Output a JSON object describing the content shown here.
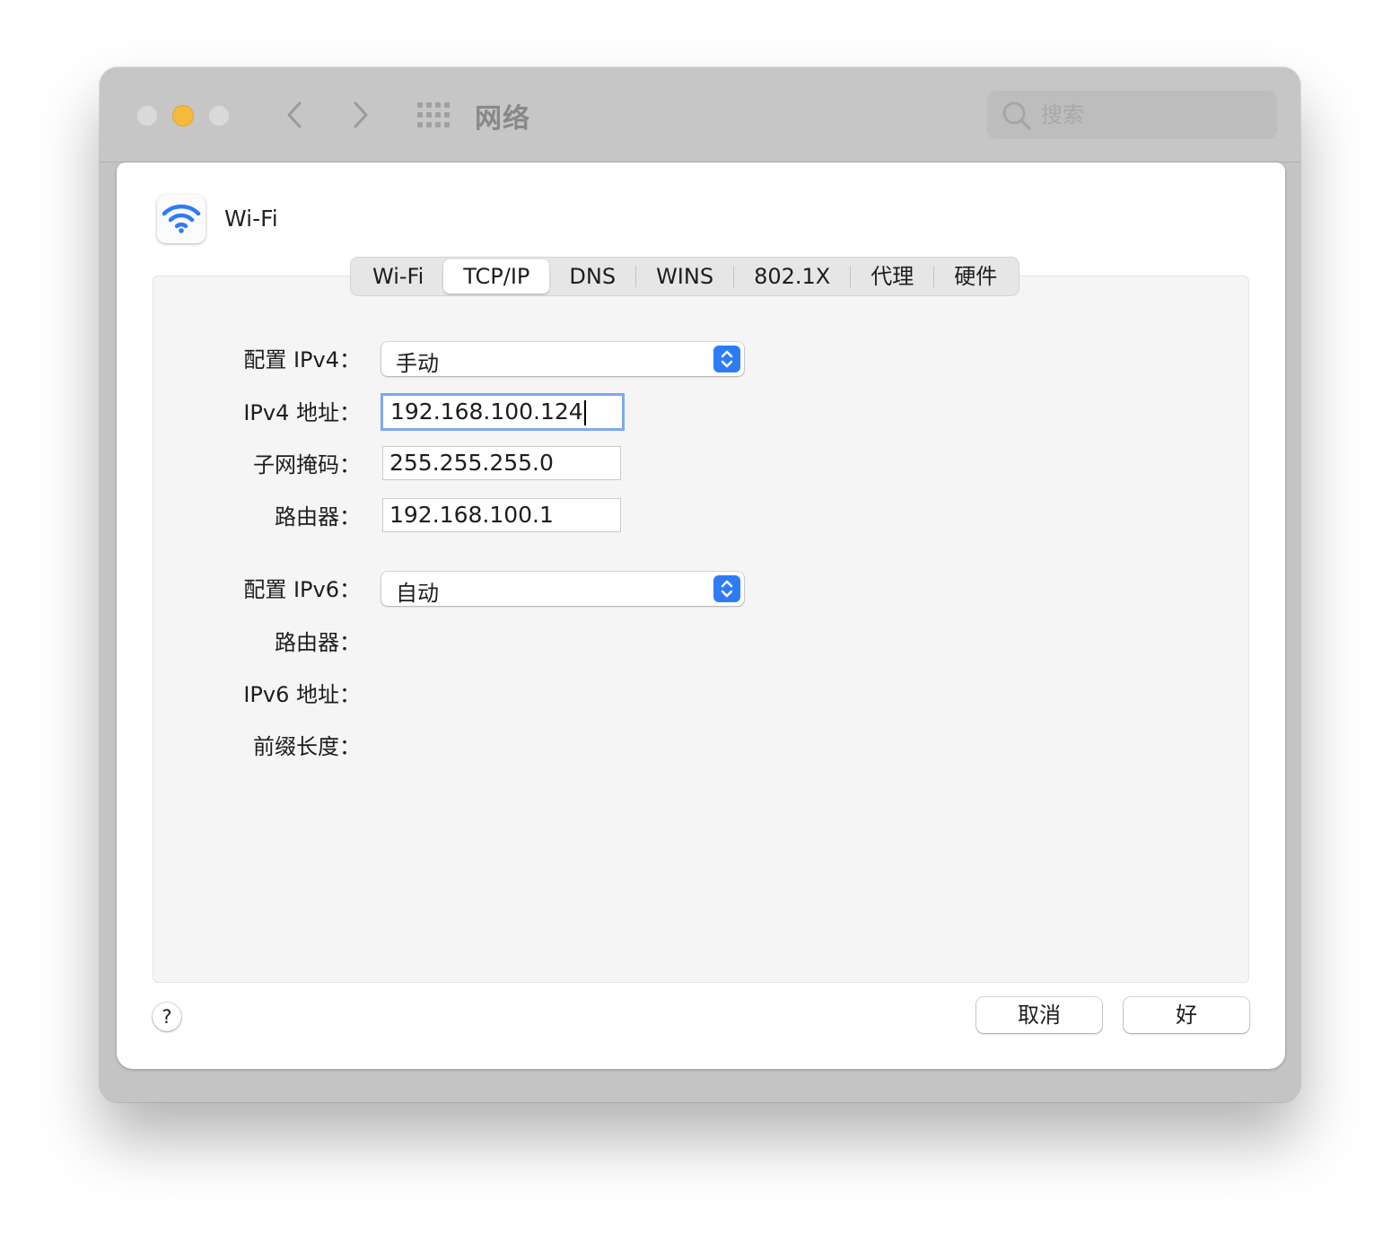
{
  "window": {
    "title": "网络",
    "search_placeholder": "搜索"
  },
  "interface": {
    "name": "Wi-Fi",
    "icon": "wifi-icon"
  },
  "tabs": [
    {
      "label": "Wi-Fi",
      "active": false
    },
    {
      "label": "TCP/IP",
      "active": true
    },
    {
      "label": "DNS",
      "active": false
    },
    {
      "label": "WINS",
      "active": false
    },
    {
      "label": "802.1X",
      "active": false
    },
    {
      "label": "代理",
      "active": false
    },
    {
      "label": "硬件",
      "active": false
    }
  ],
  "form": {
    "configure_ipv4_label": "配置 IPv4：",
    "configure_ipv4_value": "手动",
    "ipv4_address_label": "IPv4 地址：",
    "ipv4_address_value": "192.168.100.124",
    "subnet_mask_label": "子网掩码：",
    "subnet_mask_value": "255.255.255.0",
    "router_label": "路由器：",
    "router_value": "192.168.100.1",
    "configure_ipv6_label": "配置 IPv6：",
    "configure_ipv6_value": "自动",
    "ipv6_router_label": "路由器：",
    "ipv6_address_label": "IPv6 地址：",
    "prefix_length_label": "前缀长度："
  },
  "buttons": {
    "help": "?",
    "cancel": "取消",
    "ok": "好"
  },
  "colors": {
    "accent": "#2d7cf6",
    "focus_ring": "#7fa8f0",
    "minimize": "#f5b93e",
    "wifi": "#2d7cf6"
  }
}
